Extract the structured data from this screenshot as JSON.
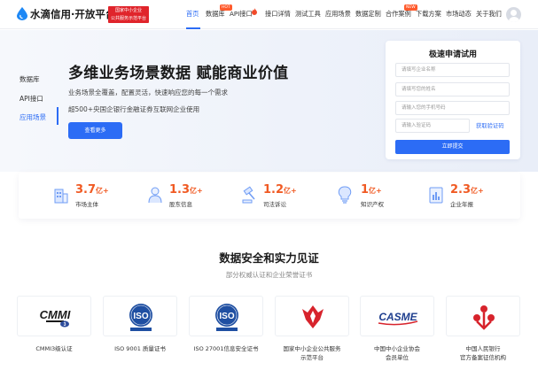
{
  "nav": {
    "logo_text": "水滴信用·开放平台",
    "badge_line1": "国家中小企业",
    "badge_line2": "公共服务示范平台",
    "menu": [
      {
        "label": "首页",
        "active": true
      },
      {
        "label": "数据库",
        "tag": "HOT"
      },
      {
        "label": "API接口",
        "tag": ""
      },
      {
        "label": "接口详情"
      },
      {
        "label": "测试工具"
      },
      {
        "label": "应用场景"
      },
      {
        "label": "数据定制"
      },
      {
        "label": "合作案例",
        "tag": "NEW"
      },
      {
        "label": "下载方案"
      },
      {
        "label": "市场动态"
      },
      {
        "label": "关于我们"
      }
    ],
    "accent_color": "#2c6cf5"
  },
  "hero": {
    "side_menu": [
      "数据库",
      "API接口",
      "应用场景"
    ],
    "side_active": "应用场景",
    "title": "多维业务场景数据  赋能商业价值",
    "sub1": "业务场景全覆盖，配置灵活，快速响应您的每一个需求",
    "sub2": "超500+央国企银行金融证券互联网企业使用",
    "button": "查看更多"
  },
  "form": {
    "title": "极速申请试用",
    "company_placeholder": "请填写企业名称",
    "name_placeholder": "请填写您的姓名",
    "phone_placeholder": "请输入您的手机号码",
    "code_placeholder": "请输入验证码",
    "code_link": "获取验证码",
    "submit": "立即提交"
  },
  "stats": [
    {
      "num": "3.7",
      "unit": "亿+",
      "label": "市场主体",
      "icon": "building-icon"
    },
    {
      "num": "1.3",
      "unit": "亿+",
      "label": "股东信息",
      "icon": "person-icon"
    },
    {
      "num": "1.2",
      "unit": "亿+",
      "label": "司法诉讼",
      "icon": "gavel-icon"
    },
    {
      "num": "1",
      "unit": "亿+",
      "label": "知识产权",
      "icon": "bulb-icon"
    },
    {
      "num": "2.3",
      "unit": "亿+",
      "label": "企业年报",
      "icon": "report-icon"
    }
  ],
  "stat_color": "#f05a23",
  "certs_section": {
    "title": "数据安全和实力见证",
    "subtitle": "部分权威认证和企业荣誉证书",
    "items": [
      {
        "label1": "CMMI3级认证",
        "label2": "",
        "logo": "CMMI"
      },
      {
        "label1": "ISO 9001 质量证书",
        "label2": "",
        "logo": "ISO"
      },
      {
        "label1": "ISO 27001信息安全证书",
        "label2": "",
        "logo": "ISO"
      },
      {
        "label1": "国家中小企业公共服务",
        "label2": "示范平台",
        "logo": ""
      },
      {
        "label1": "中国中小企业协会",
        "label2": "会员单位",
        "logo": "CASME"
      },
      {
        "label1": "中国人民银行",
        "label2": "官方备案征信机构",
        "logo": ""
      }
    ]
  }
}
